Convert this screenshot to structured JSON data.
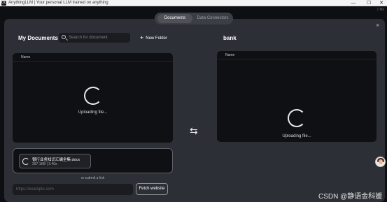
{
  "window": {
    "icon_text": "OO",
    "title": "AnythingLLM | Your personal LLM trained on anything",
    "controls": {
      "minimize": "—",
      "maximize": "☐",
      "close": "✕"
    }
  },
  "topbar_hint": "1 file",
  "tabs": [
    {
      "label": "Documents",
      "active": true
    },
    {
      "label": "Data Connectors",
      "active": false
    }
  ],
  "modal_close": "×",
  "my_documents": {
    "title": "My Documents",
    "search_placeholder": "Search for document",
    "new_folder_label": "New Folder",
    "column_name": "Name",
    "uploading_text": "Uploading file..."
  },
  "workspace": {
    "title": "bank",
    "column_name": "Name",
    "uploading_text": "Uploading file..."
  },
  "swap_icon": "⇆",
  "upload": {
    "file_name": "银行业务知识汇编全集.docx",
    "file_meta": "397.1KB | 3.40s"
  },
  "link": {
    "or_text": "or submit a link",
    "url_placeholder": "https://example.com",
    "fetch_label": "Fetch website"
  },
  "watermark": "CSDN @静语金科媛",
  "colors": {
    "modal_bg": "#2c2f35",
    "panel_bg": "#0f1013",
    "app_bg": "#0e0f12"
  }
}
